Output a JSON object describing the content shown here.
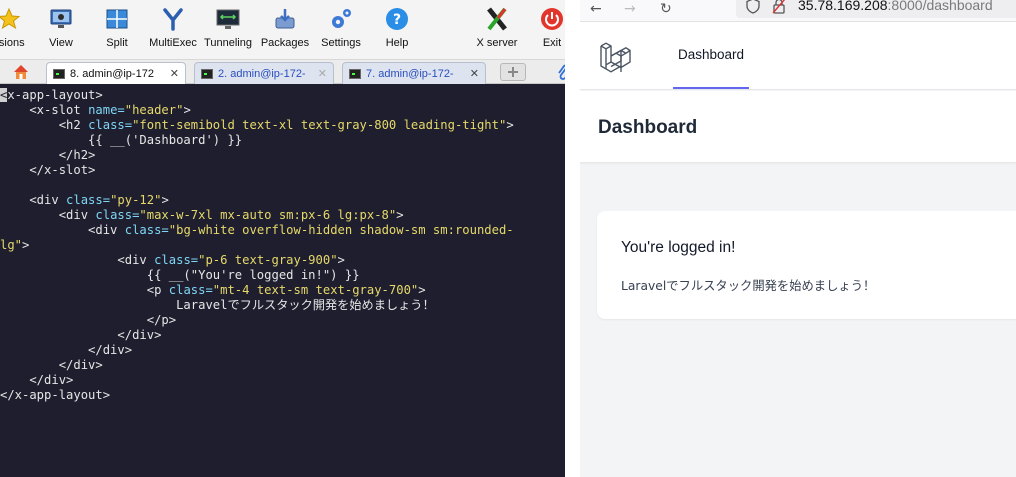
{
  "mobaxterm": {
    "toolbar": [
      {
        "label": "ssions",
        "icon": "star-icon"
      },
      {
        "label": "View",
        "icon": "monitor-icon"
      },
      {
        "label": "Split",
        "icon": "split-icon"
      },
      {
        "label": "MultiExec",
        "icon": "multiexec-icon"
      },
      {
        "label": "Tunneling",
        "icon": "tunneling-icon"
      },
      {
        "label": "Packages",
        "icon": "packages-icon"
      },
      {
        "label": "Settings",
        "icon": "gear-icon"
      },
      {
        "label": "Help",
        "icon": "help-icon"
      },
      {
        "label": "X server",
        "icon": "x-server-icon"
      },
      {
        "label": "Exit",
        "icon": "power-icon"
      }
    ],
    "tabs": [
      {
        "label": "8. admin@ip-172",
        "close": "✕",
        "active": true
      },
      {
        "label": "2. admin@ip-172-",
        "close": "✕",
        "active": false
      },
      {
        "label": "7. admin@ip-172-",
        "close": "✕",
        "active": false
      }
    ],
    "code_lines": [
      [
        [
          "tg",
          "<x-app-layout>"
        ]
      ],
      [
        [
          "tg",
          "    <x-slot "
        ],
        [
          "an",
          "name="
        ],
        [
          "av",
          "\"header\""
        ],
        [
          "tg",
          ">"
        ]
      ],
      [
        [
          "tg",
          "        <h2 "
        ],
        [
          "an",
          "class="
        ],
        [
          "av",
          "\"font-semibold text-xl text-gray-800 leading-tight\""
        ],
        [
          "tg",
          ">"
        ]
      ],
      [
        [
          "tg",
          "            {{ __('Dashboard') }}"
        ]
      ],
      [
        [
          "tg",
          "        </h2>"
        ]
      ],
      [
        [
          "tg",
          "    </x-slot>"
        ]
      ],
      [
        [
          "tg",
          ""
        ]
      ],
      [
        [
          "tg",
          "    <div "
        ],
        [
          "an",
          "class="
        ],
        [
          "av",
          "\"py-12\""
        ],
        [
          "tg",
          ">"
        ]
      ],
      [
        [
          "tg",
          "        <div "
        ],
        [
          "an",
          "class="
        ],
        [
          "av",
          "\"max-w-7xl mx-auto sm:px-6 lg:px-8\""
        ],
        [
          "tg",
          ">"
        ]
      ],
      [
        [
          "tg",
          "            <div "
        ],
        [
          "an",
          "class="
        ],
        [
          "av",
          "\"bg-white overflow-hidden shadow-sm sm:rounded-"
        ]
      ],
      [
        [
          "av",
          "lg\""
        ],
        [
          "tg",
          ">"
        ]
      ],
      [
        [
          "tg",
          "                <div "
        ],
        [
          "an",
          "class="
        ],
        [
          "av",
          "\"p-6 text-gray-900\""
        ],
        [
          "tg",
          ">"
        ]
      ],
      [
        [
          "tg",
          "                    {{ __(\"You're logged in!\") }}"
        ]
      ],
      [
        [
          "tg",
          "                    <p "
        ],
        [
          "an",
          "class="
        ],
        [
          "av",
          "\"mt-4 text-sm text-gray-700\""
        ],
        [
          "tg",
          ">"
        ]
      ],
      [
        [
          "tg",
          "                        Laravelでフルスタック開発を始めましょう！"
        ]
      ],
      [
        [
          "tg",
          "                    </p>"
        ]
      ],
      [
        [
          "tg",
          "                </div>"
        ]
      ],
      [
        [
          "tg",
          "            </div>"
        ]
      ],
      [
        [
          "tg",
          "        </div>"
        ]
      ],
      [
        [
          "tg",
          "    </div>"
        ]
      ],
      [
        [
          "tg",
          "</x-app-layout>"
        ]
      ]
    ]
  },
  "browser": {
    "url_host": "35.78.169.208",
    "url_rest": ":8000/dashboard",
    "nav_link": "Dashboard",
    "page_title": "Dashboard",
    "card_title": "You're logged in!",
    "card_text": "Laravelでフルスタック開発を始めましょう！"
  }
}
